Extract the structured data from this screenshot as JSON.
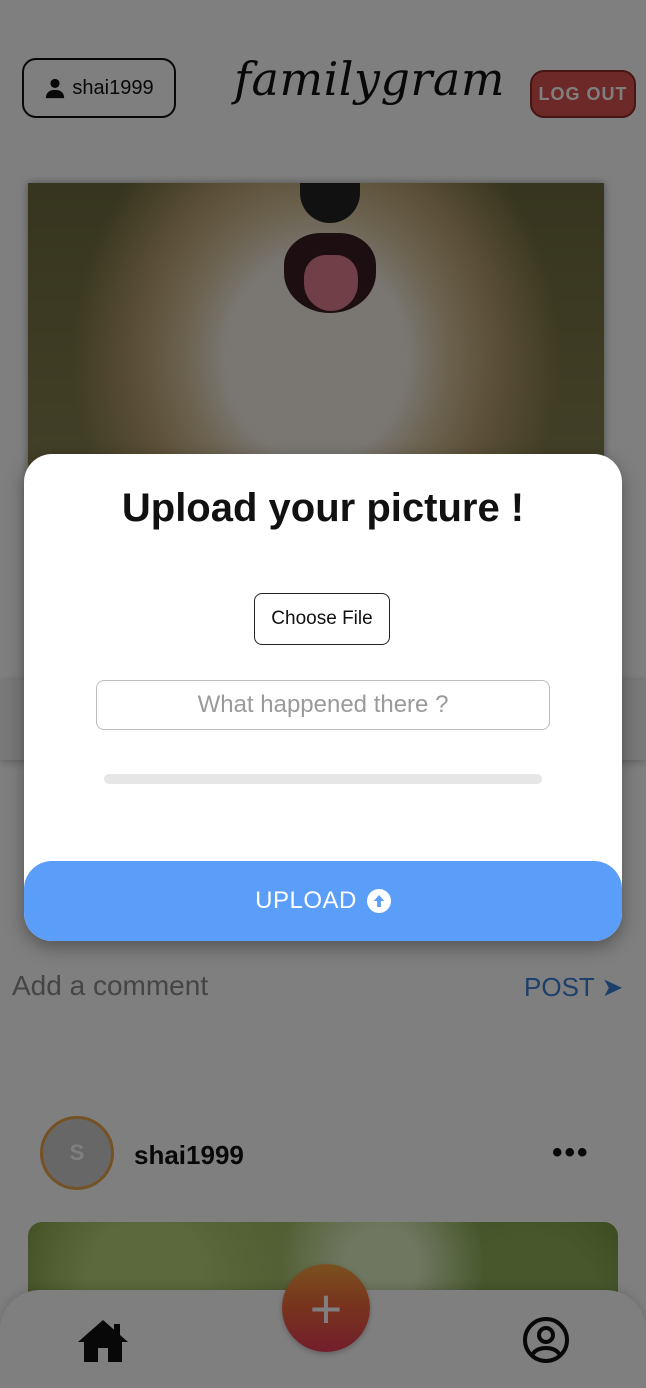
{
  "header": {
    "username": "shai1999",
    "logo": "familygram",
    "logout_label": "LOG OUT"
  },
  "feed": {
    "comment_placeholder": "Add a comment",
    "post_label": "POST ➤",
    "post2": {
      "avatar_initial": "S",
      "username": "shai1999",
      "more_label": "•••"
    }
  },
  "modal": {
    "title": "Upload your picture !",
    "choose_file_label": "Choose File",
    "caption_placeholder": "What happened there ?",
    "progress": 0,
    "upload_label": "UPLOAD"
  },
  "bottom_nav": {
    "add_label": "+"
  },
  "colors": {
    "accent_blue": "#5b9ef9",
    "logout_red": "#d9534f",
    "add_gradient_start": "#f6a340",
    "add_gradient_end": "#e73c5a"
  }
}
